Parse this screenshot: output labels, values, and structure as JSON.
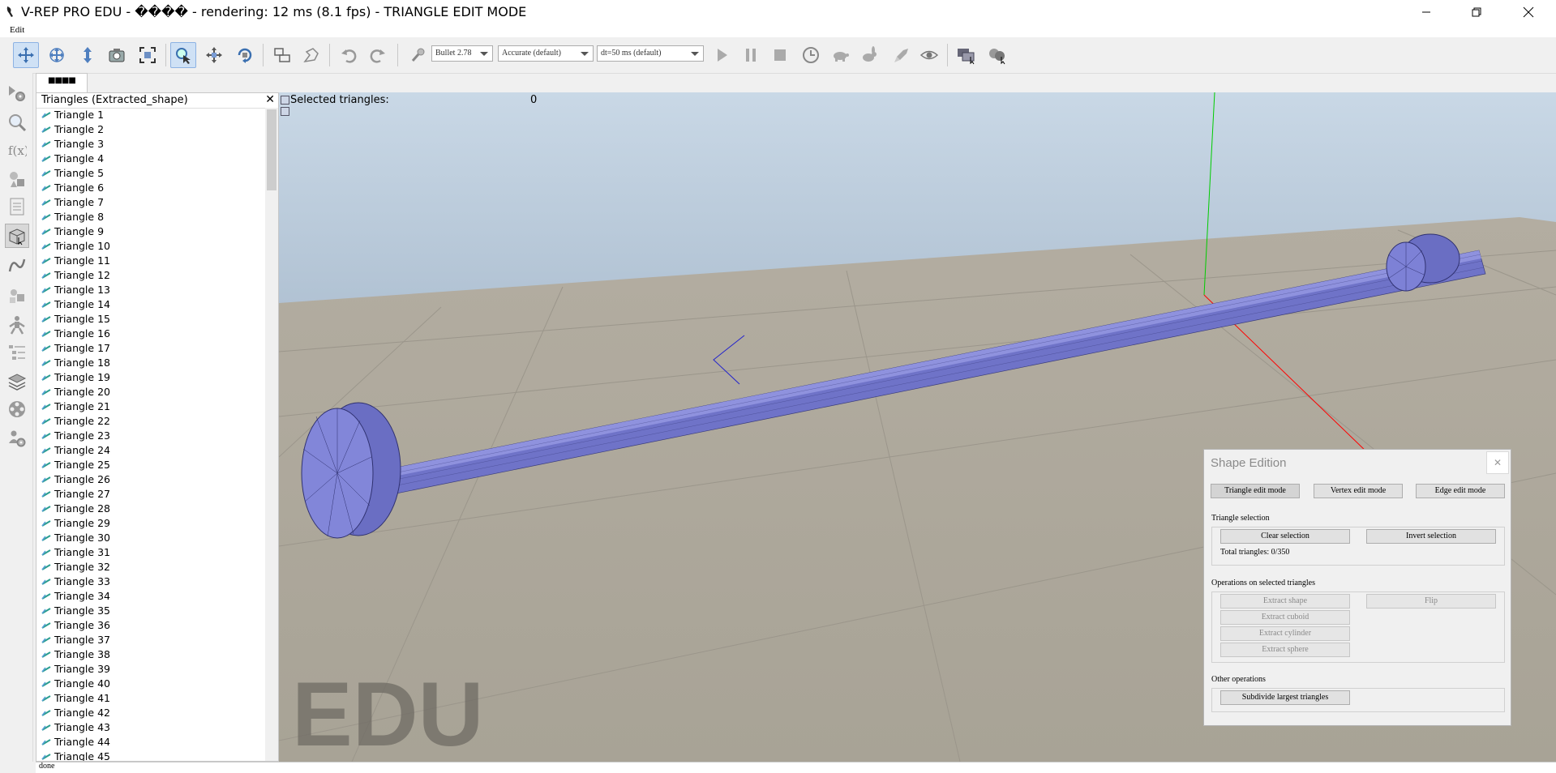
{
  "window": {
    "title": "V-REP PRO EDU - ���� - rendering: 12 ms (8.1 fps) - TRIANGLE EDIT MODE",
    "minimize": "—",
    "maximize": "❐",
    "close": "✕"
  },
  "menu": {
    "edit": "Edit"
  },
  "toolbar": {
    "engine": "Bullet 2.78",
    "accuracy": "Accurate (default)",
    "timestep": "dt=50 ms (default)"
  },
  "hierarchy": {
    "tab_label": "■■■■",
    "title": "Triangles (Extracted_shape)",
    "close": "✕",
    "items": [
      "Triangle 1",
      "Triangle 2",
      "Triangle 3",
      "Triangle 4",
      "Triangle 5",
      "Triangle 6",
      "Triangle 7",
      "Triangle 8",
      "Triangle 9",
      "Triangle 10",
      "Triangle 11",
      "Triangle 12",
      "Triangle 13",
      "Triangle 14",
      "Triangle 15",
      "Triangle 16",
      "Triangle 17",
      "Triangle 18",
      "Triangle 19",
      "Triangle 20",
      "Triangle 21",
      "Triangle 22",
      "Triangle 23",
      "Triangle 24",
      "Triangle 25",
      "Triangle 26",
      "Triangle 27",
      "Triangle 28",
      "Triangle 29",
      "Triangle 30",
      "Triangle 31",
      "Triangle 32",
      "Triangle 33",
      "Triangle 34",
      "Triangle 35",
      "Triangle 36",
      "Triangle 37",
      "Triangle 38",
      "Triangle 39",
      "Triangle 40",
      "Triangle 41",
      "Triangle 42",
      "Triangle 43",
      "Triangle 44",
      "Triangle 45"
    ]
  },
  "viewport": {
    "selected_label": "Selected triangles:",
    "selected_value": "0",
    "watermark": "EDU"
  },
  "dialog": {
    "title": "Shape Edition",
    "close": "✕",
    "mode_triangle": "Triangle edit mode",
    "mode_vertex": "Vertex edit mode",
    "mode_edge": "Edge edit mode",
    "selection_group": "Triangle selection",
    "clear_selection": "Clear selection",
    "invert_selection": "Invert selection",
    "total_triangles": "Total triangles: 0/350",
    "ops_group": "Operations on selected triangles",
    "extract_shape": "Extract shape",
    "flip": "Flip",
    "extract_cuboid": "Extract cuboid",
    "extract_cylinder": "Extract cylinder",
    "extract_sphere": "Extract sphere",
    "other_group": "Other operations",
    "subdivide": "Subdivide largest triangles"
  },
  "status": {
    "text": "done"
  },
  "colors": {
    "sky_top": "#b9cde0",
    "floor": "#c4beb1",
    "mesh": "#7b7fd6",
    "axis_x": "#ff0000",
    "axis_y": "#00cc00",
    "axis_z": "#0000ff"
  }
}
